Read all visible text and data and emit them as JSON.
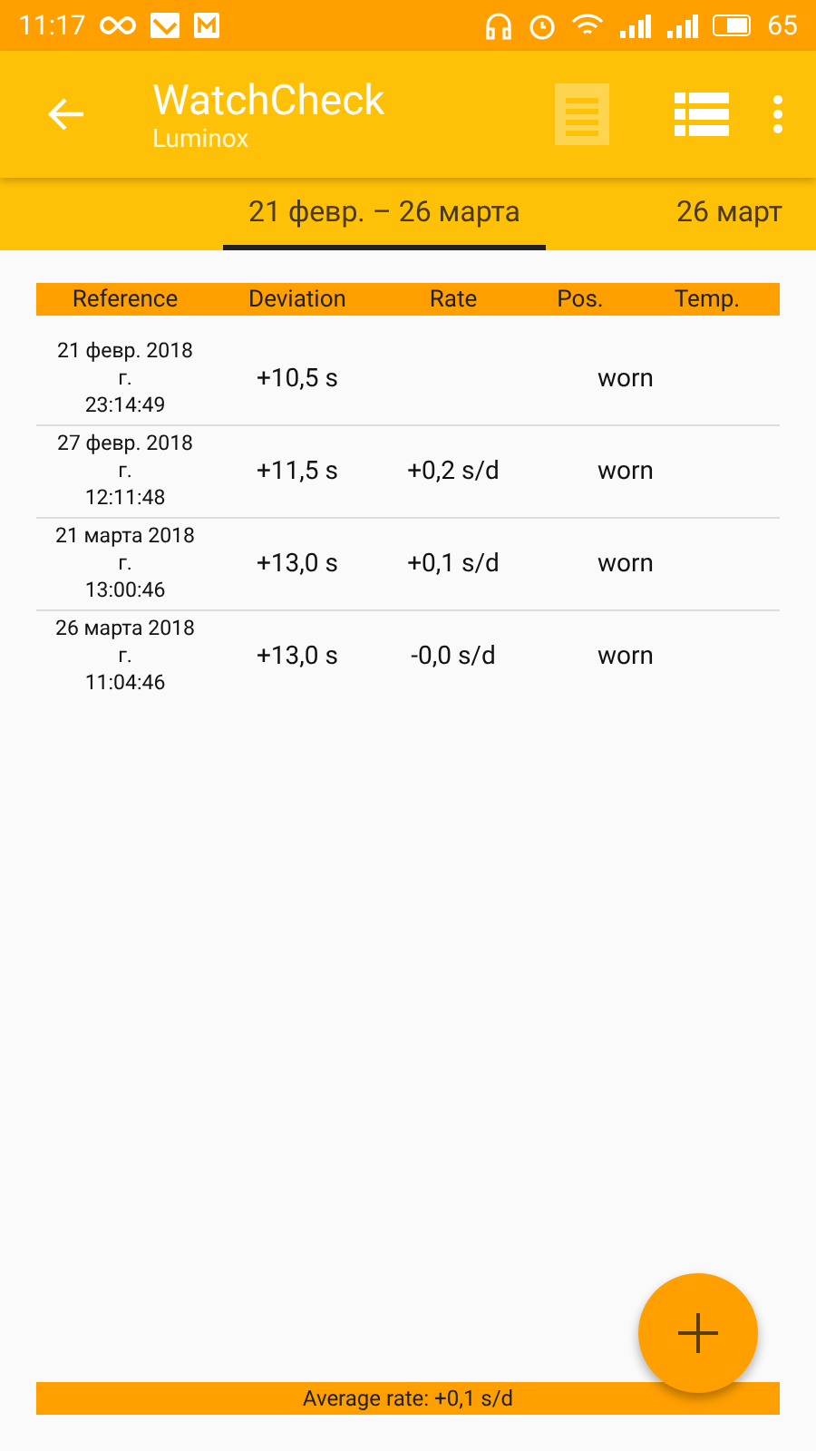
{
  "status_bar": {
    "time": "11:17",
    "battery": "65"
  },
  "app_bar": {
    "title": "WatchCheck",
    "subtitle": "Luminox"
  },
  "tabs": [
    {
      "label": "21 февр. – 26 марта",
      "selected": true
    },
    {
      "label": "26 март",
      "selected": false
    }
  ],
  "table": {
    "columns": [
      "Reference",
      "Deviation",
      "Rate",
      "Pos.",
      "Temp."
    ],
    "rows": [
      {
        "reference": "21 февр. 2018\nг.\n23:14:49",
        "deviation": "+10,5 s",
        "rate": "",
        "pos": "worn"
      },
      {
        "reference": "27 февр. 2018\nг.\n12:11:48",
        "deviation": "+11,5 s",
        "rate": "+0,2 s/d",
        "pos": "worn"
      },
      {
        "reference": "21 марта 2018\nг.\n13:00:46",
        "deviation": "+13,0 s",
        "rate": "+0,1 s/d",
        "pos": "worn"
      },
      {
        "reference": "26 марта 2018\nг.\n11:04:46",
        "deviation": "+13,0 s",
        "rate": "-0,0 s/d",
        "pos": "worn"
      }
    ]
  },
  "footer": {
    "average": "Average rate: +0,1 s/d"
  }
}
